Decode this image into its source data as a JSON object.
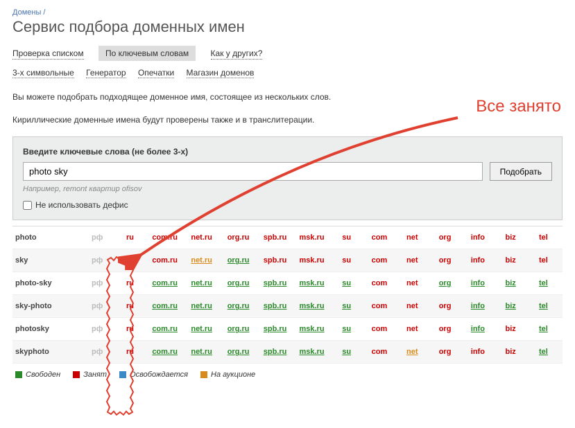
{
  "breadcrumb": {
    "link": "Домены",
    "sep": "/"
  },
  "title": "Сервис подбора доменных имен",
  "tabs": {
    "t0": "Проверка списком",
    "t1": "По ключевым словам",
    "t2": "Как у других?"
  },
  "subtabs": {
    "s0": "3-х символьные",
    "s1": "Генератор",
    "s2": "Опечатки",
    "s3": "Магазин доменов"
  },
  "desc1": "Вы можете подобрать подходящее доменное имя, состоящее из нескольких слов.",
  "desc2": "Кириллические доменные имена будут проверены также и в транслитерации.",
  "search": {
    "label": "Введите ключевые слова (не более 3-х)",
    "value": "photo sky",
    "button": "Подобрать",
    "hint": "Например, remont квартир ofisov",
    "checkbox": "Не использовать дефис"
  },
  "zones": [
    "рф",
    "ru",
    "com.ru",
    "net.ru",
    "org.ru",
    "spb.ru",
    "msk.ru",
    "su",
    "com",
    "net",
    "org",
    "info",
    "biz",
    "tel"
  ],
  "rows": [
    {
      "key": "photo",
      "cells": [
        "muted",
        "taken",
        "taken",
        "taken",
        "taken",
        "taken",
        "taken",
        "taken",
        "taken",
        "taken",
        "taken",
        "taken",
        "taken",
        "taken"
      ]
    },
    {
      "key": "sky",
      "cells": [
        "muted",
        "taken",
        "taken",
        "auction",
        "free",
        "taken",
        "taken",
        "taken",
        "taken",
        "taken",
        "taken",
        "taken",
        "taken",
        "taken"
      ]
    },
    {
      "key": "photo-sky",
      "cells": [
        "muted",
        "taken",
        "free",
        "free",
        "free",
        "free",
        "free",
        "free",
        "taken",
        "taken",
        "free",
        "free",
        "free",
        "free"
      ]
    },
    {
      "key": "sky-photo",
      "cells": [
        "muted",
        "taken",
        "free",
        "free",
        "free",
        "free",
        "free",
        "free",
        "taken",
        "taken",
        "taken",
        "free",
        "free",
        "free"
      ]
    },
    {
      "key": "photosky",
      "cells": [
        "muted",
        "taken",
        "free",
        "free",
        "free",
        "free",
        "free",
        "free",
        "taken",
        "taken",
        "taken",
        "free",
        "taken",
        "free"
      ]
    },
    {
      "key": "skyphoto",
      "cells": [
        "muted",
        "taken",
        "free",
        "free",
        "free",
        "free",
        "free",
        "free",
        "taken",
        "auction",
        "taken",
        "taken",
        "taken",
        "free"
      ]
    }
  ],
  "legend": {
    "free": "Свободен",
    "taken": "Занят",
    "releasing": "Освобождается",
    "auction": "На аукционе"
  },
  "annotation": "Все занято"
}
